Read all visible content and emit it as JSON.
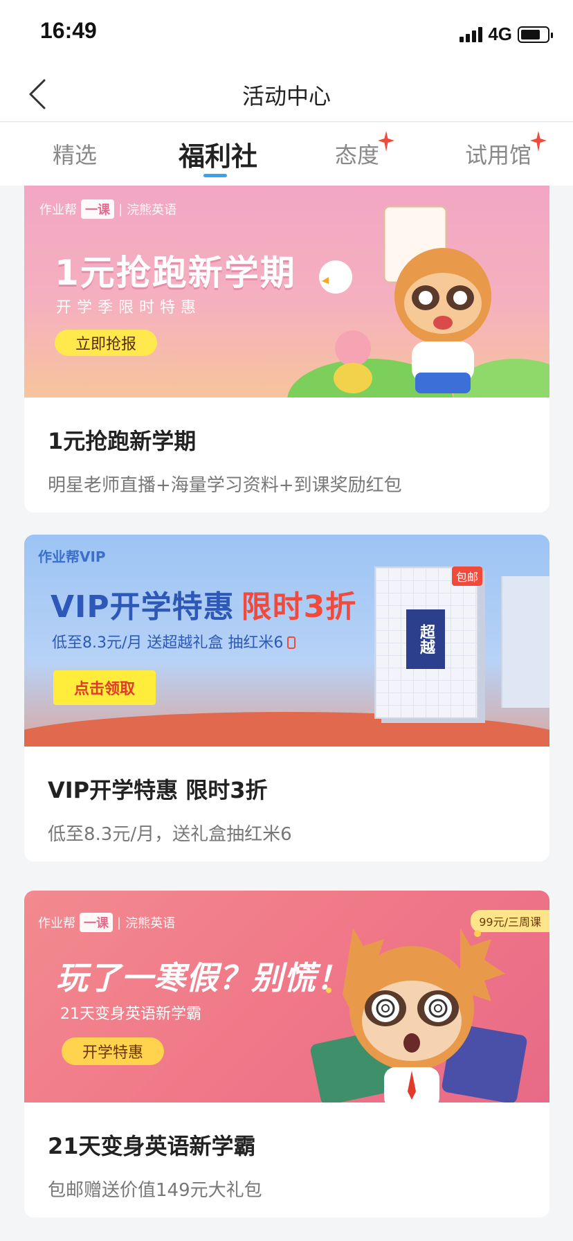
{
  "status_bar": {
    "time": "16:49",
    "network": "4G"
  },
  "nav": {
    "title": "活动中心"
  },
  "tabs": [
    {
      "label": "精选",
      "active": false,
      "badge": false
    },
    {
      "label": "福利社",
      "active": true,
      "badge": false
    },
    {
      "label": "态度",
      "active": false,
      "badge": true
    },
    {
      "label": "试用馆",
      "active": false,
      "badge": true
    }
  ],
  "colors": {
    "accent": "#3aa0f0",
    "badge": "#f04a3c"
  },
  "cards": [
    {
      "banner": {
        "brand_a": "作业帮",
        "brand_pill": "一课",
        "brand_b": "浣熊英语",
        "headline": "1元抢跑新学期",
        "subline": "开学季限时特惠",
        "cta": "立即抢报"
      },
      "title": "1元抢跑新学期",
      "desc": "明星老师直播+海量学习资料+到课奖励红包"
    },
    {
      "banner": {
        "brand": "作业帮VIP",
        "headline_a": "VIP开学特惠",
        "headline_b": "限时3折",
        "subline": "低至8.3元/月 送超越礼盒 抽红米6",
        "cta": "点击领取",
        "box_tag": "包邮",
        "box_label": "超越"
      },
      "title": "VIP开学特惠 限时3折",
      "desc": "低至8.3元/月，送礼盒抽红米6"
    },
    {
      "banner": {
        "brand_a": "作业帮",
        "brand_pill": "一课",
        "brand_b": "浣熊英语",
        "price_tag": "99元/三周课",
        "headline": "玩了一寒假？别慌！",
        "subline": "21天变身英语新学霸",
        "cta": "开学特惠"
      },
      "title": "21天变身英语新学霸",
      "desc": "包邮赠送价值149元大礼包"
    }
  ]
}
